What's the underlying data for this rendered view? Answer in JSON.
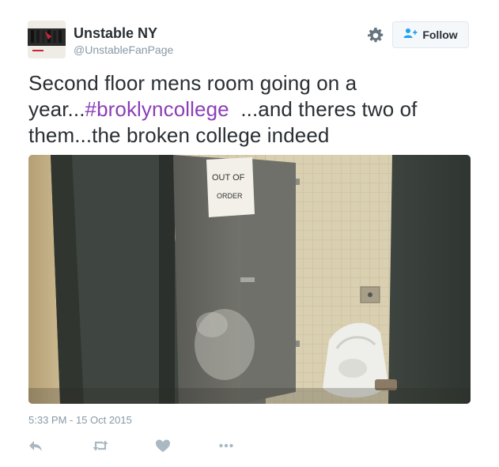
{
  "author": {
    "name": "Unstable NY",
    "handle": "@UnstableFanPage"
  },
  "follow_button": {
    "label": "Follow",
    "icon": "follow-person-icon"
  },
  "tweet": {
    "text_before": "Second floor mens room going on a year...",
    "hashtag": "#broklyncollege",
    "text_after": "  ...and theres two of them...the broken college indeed"
  },
  "media": {
    "sign_line1": "OUT OF",
    "sign_line2": "ORDER"
  },
  "timestamp": "5:33 PM - 15 Oct 2015",
  "actions": [
    "reply-icon",
    "retweet-icon",
    "like-icon",
    "more-icon"
  ],
  "colors": {
    "hashtag": "#8a3fb8",
    "secondary_text": "#8899a6",
    "follow_icon": "#1da1f2"
  }
}
